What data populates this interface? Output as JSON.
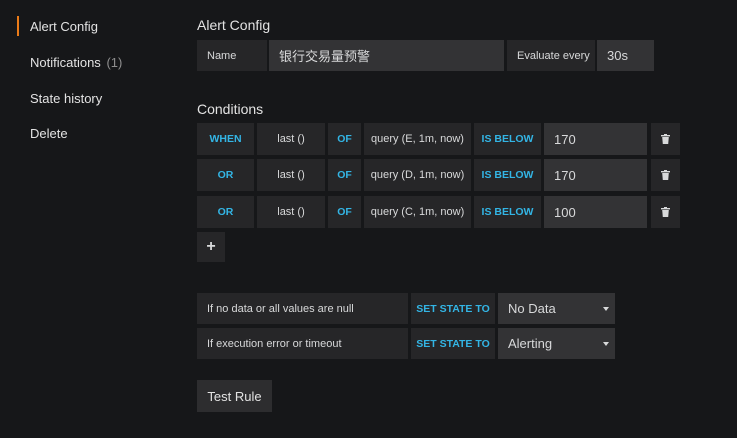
{
  "sidebar": {
    "items": [
      {
        "label": "Alert Config",
        "count": ""
      },
      {
        "label": "Notifications",
        "count": "(1)"
      },
      {
        "label": "State history",
        "count": ""
      },
      {
        "label": "Delete",
        "count": ""
      }
    ]
  },
  "alert_config": {
    "title": "Alert Config",
    "name_label": "Name",
    "name_value": "银行交易量预警",
    "evaluate_label": "Evaluate every",
    "evaluate_value": "30s"
  },
  "conditions": {
    "title": "Conditions",
    "rows": [
      {
        "op": "WHEN",
        "func": "last ()",
        "of": "OF",
        "query": "query (E, 1m, now)",
        "cmp": "IS BELOW",
        "value": "170"
      },
      {
        "op": "OR",
        "func": "last ()",
        "of": "OF",
        "query": "query (D, 1m, now)",
        "cmp": "IS BELOW",
        "value": "170"
      },
      {
        "op": "OR",
        "func": "last ()",
        "of": "OF",
        "query": "query (C, 1m, now)",
        "cmp": "IS BELOW",
        "value": "100"
      }
    ],
    "add_label": "+"
  },
  "states": {
    "rows": [
      {
        "label": "If no data or all values are null",
        "action": "SET STATE TO",
        "value": "No Data"
      },
      {
        "label": "If execution error or timeout",
        "action": "SET STATE TO",
        "value": "Alerting"
      }
    ]
  },
  "test_rule_label": "Test Rule",
  "colors": {
    "accent": "#eb7b18",
    "keyword": "#33b5e5",
    "background": "#161719"
  }
}
